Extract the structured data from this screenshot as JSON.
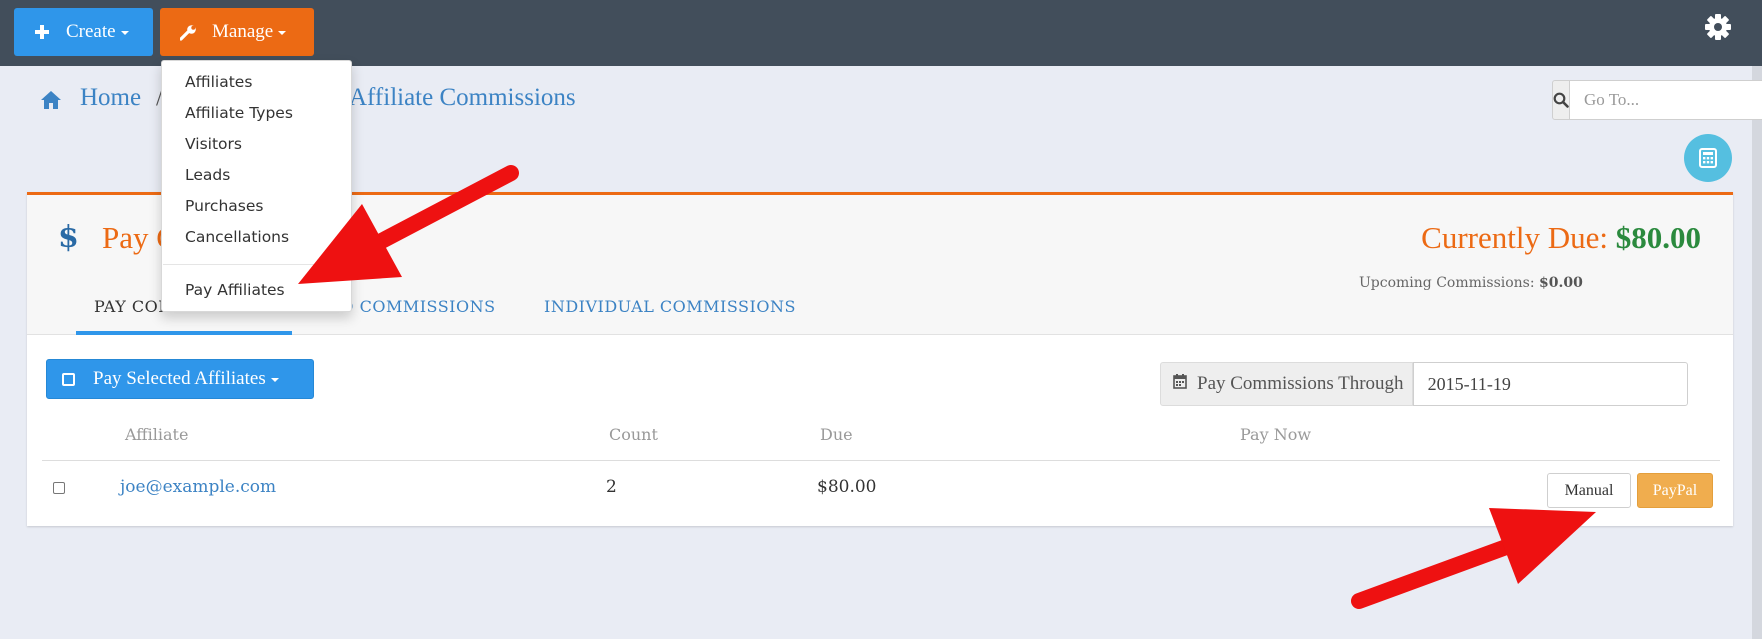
{
  "topbar": {
    "create_label": "Create",
    "manage_label": "Manage"
  },
  "manage_menu": {
    "items": [
      "Affiliates",
      "Affiliate Types",
      "Visitors",
      "Leads",
      "Purchases",
      "Cancellations"
    ],
    "pay_affiliates_label": "Pay Affiliates"
  },
  "breadcrumb": {
    "home": "Home",
    "separator": "/",
    "current": "Affiliate Commissions"
  },
  "goto": {
    "placeholder": "Go To..."
  },
  "panel": {
    "title": "Pay Commissions",
    "currently_due_label": "Currently Due:",
    "currently_due_amount": "$80.00",
    "upcoming_label": "Upcoming Commissions:",
    "upcoming_amount": "$0.00"
  },
  "tabs": {
    "pay": "PAY COMMISSIONS",
    "paid": "PAID COMMISSIONS",
    "individual": "INDIVIDUAL COMMISSIONS"
  },
  "toolbar": {
    "pay_selected_label": "Pay Selected Affiliates",
    "through_label": "Pay Commissions Through",
    "through_date": "2015-11-19"
  },
  "table": {
    "headers": {
      "affiliate": "Affiliate",
      "count": "Count",
      "due": "Due",
      "pay_now": "Pay Now"
    },
    "rows": [
      {
        "affiliate": "joe@example.com",
        "count": "2",
        "due": "$80.00",
        "manual_label": "Manual",
        "paypal_label": "PayPal"
      }
    ]
  },
  "colors": {
    "topbar": "#424e5b",
    "create_button": "#2f96ea",
    "manage_button": "#ec6a14",
    "title_orange": "#ec6a14",
    "due_green": "#2b8a3e",
    "link_blue": "#3c83c4",
    "paypal_button": "#f0ad4e",
    "arrow_red": "#ee1111"
  },
  "icons": [
    "plus-icon",
    "wrench-icon",
    "gear-icon",
    "home-icon",
    "search-icon",
    "calculator-icon",
    "dollar-icon",
    "square-icon",
    "calendar-icon"
  ]
}
